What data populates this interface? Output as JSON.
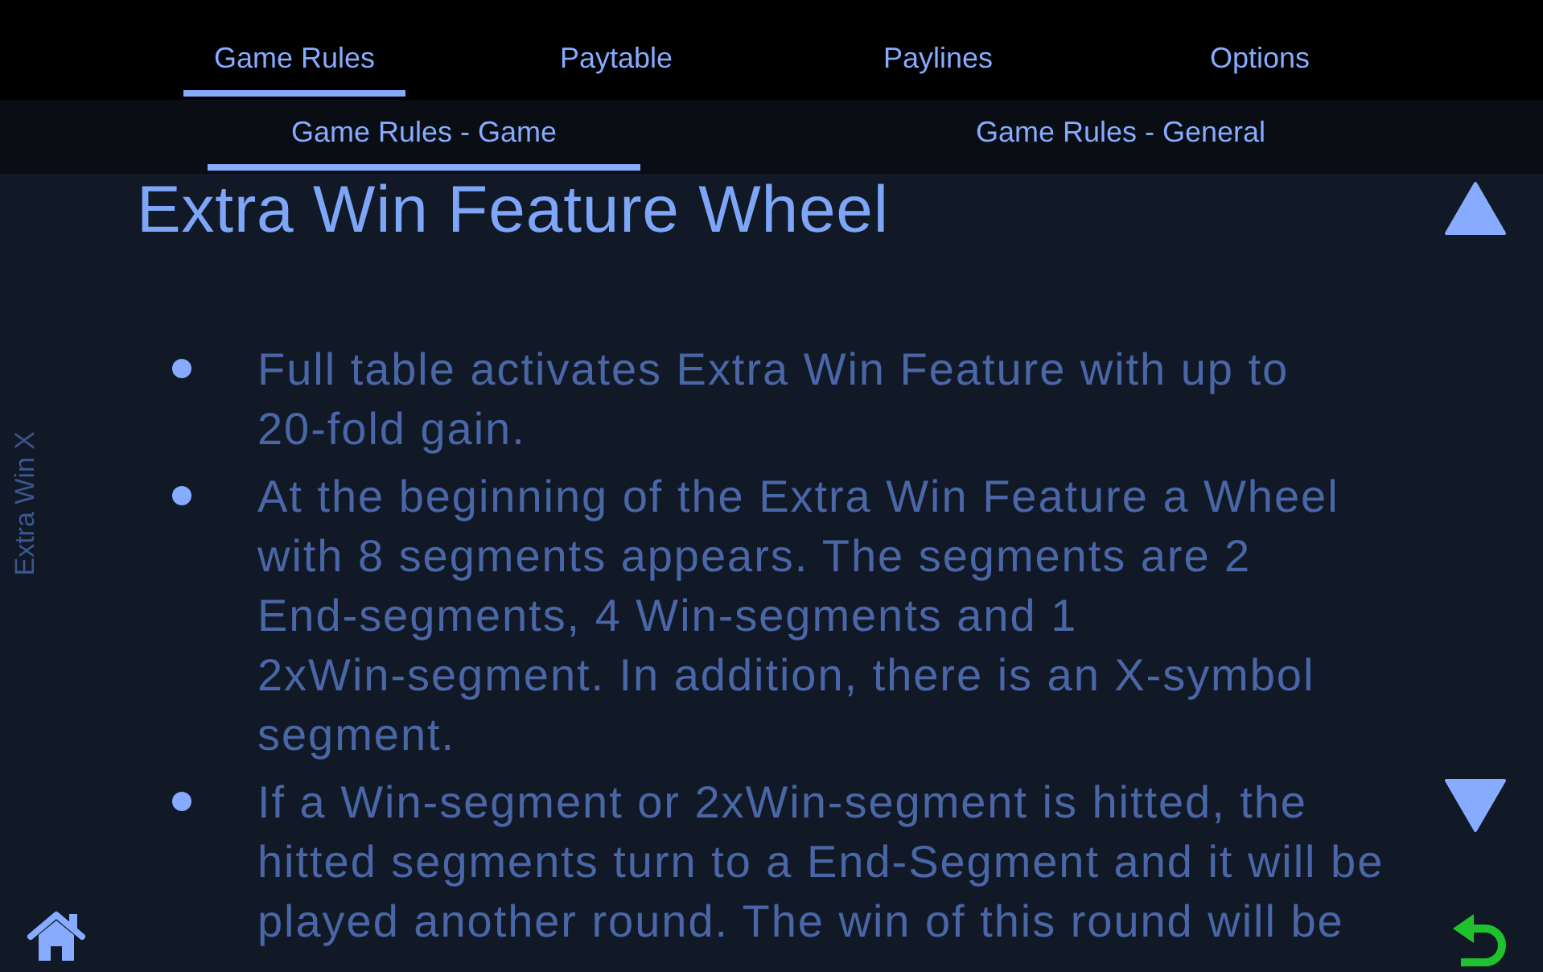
{
  "tabs": [
    {
      "label": "Game Rules",
      "selected": true
    },
    {
      "label": "Paytable",
      "selected": false
    },
    {
      "label": "Paylines",
      "selected": false
    },
    {
      "label": "Options",
      "selected": false
    }
  ],
  "subtabs": [
    {
      "label": "Game Rules - Game",
      "selected": true
    },
    {
      "label": "Game Rules - General",
      "selected": false
    }
  ],
  "side_label": "Extra Win X",
  "content": {
    "title": "Extra Win Feature Wheel",
    "bullets": [
      "Full table activates Extra Win Feature with up to 20-fold gain.",
      "At the beginning of the Extra Win Feature a Wheel with 8 segments appears. The segments are 2 End-segments, 4 Win-segments and 1 2xWin-segment. In addition, there is an X-symbol segment.",
      "If a Win-segment or 2xWin-segment is hitted, the hitted segments turn to a End-Segment and it will be played another round. The win of this round will be"
    ]
  }
}
